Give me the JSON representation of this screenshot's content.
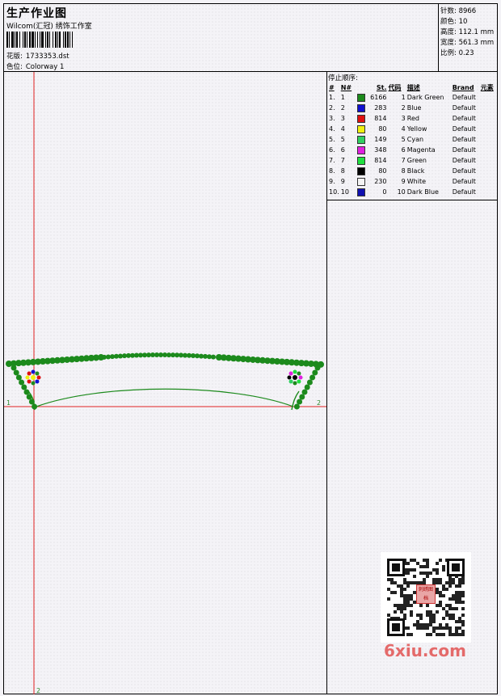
{
  "header": {
    "title": "生产作业图",
    "studio": "Wilcom(汇冠) 绣饰工作室",
    "design_label": "花版:",
    "design_file": "1733353.dst",
    "colorway_label": "色位:",
    "colorway": "Colorway 1"
  },
  "stats": {
    "stitches_label": "针数:",
    "stitches": "8966",
    "colors_label": "颜色:",
    "colors": "10",
    "height_label": "高度:",
    "height": "112.1 mm",
    "width_label": "宽度:",
    "width": "561.3 mm",
    "scale_label": "比例:",
    "scale": "0.23"
  },
  "stop_sequence": {
    "title": "停止顺序:",
    "columns": [
      "#",
      "N#",
      "St.",
      "代码",
      "描述",
      "Brand",
      "元素"
    ],
    "rows": [
      {
        "idx": "1.",
        "n": "1",
        "color": "#1c8a1c",
        "st": "6166",
        "code": "1",
        "desc": "Dark Green",
        "brand": "Default"
      },
      {
        "idx": "2.",
        "n": "2",
        "color": "#1010d0",
        "st": "283",
        "code": "2",
        "desc": "Blue",
        "brand": "Default"
      },
      {
        "idx": "3.",
        "n": "3",
        "color": "#e01010",
        "st": "814",
        "code": "3",
        "desc": "Red",
        "brand": "Default"
      },
      {
        "idx": "4.",
        "n": "4",
        "color": "#f0f010",
        "st": "80",
        "code": "4",
        "desc": "Yellow",
        "brand": "Default"
      },
      {
        "idx": "5.",
        "n": "5",
        "color": "#30d060",
        "st": "149",
        "code": "5",
        "desc": "Cyan",
        "brand": "Default"
      },
      {
        "idx": "6.",
        "n": "6",
        "color": "#e020e0",
        "st": "348",
        "code": "6",
        "desc": "Magenta",
        "brand": "Default"
      },
      {
        "idx": "7.",
        "n": "7",
        "color": "#20e040",
        "st": "814",
        "code": "7",
        "desc": "Green",
        "brand": "Default"
      },
      {
        "idx": "8.",
        "n": "8",
        "color": "#000000",
        "st": "80",
        "code": "8",
        "desc": "Black",
        "brand": "Default"
      },
      {
        "idx": "9.",
        "n": "9",
        "color": "#f4f4f4",
        "st": "230",
        "code": "9",
        "desc": "White",
        "brand": "Default"
      },
      {
        "idx": "10.",
        "n": "10",
        "color": "#1010b0",
        "st": "0",
        "code": "10",
        "desc": "Dark Blue",
        "brand": "Default"
      }
    ]
  },
  "canvas": {
    "axis_left": "1",
    "axis_right": "2",
    "axis_bottom": "2",
    "guide_color": "#e02020",
    "design_color": "#1c8a1c"
  },
  "watermark": {
    "text": "6xiu.com",
    "qr_logo": "刺绣图档"
  }
}
